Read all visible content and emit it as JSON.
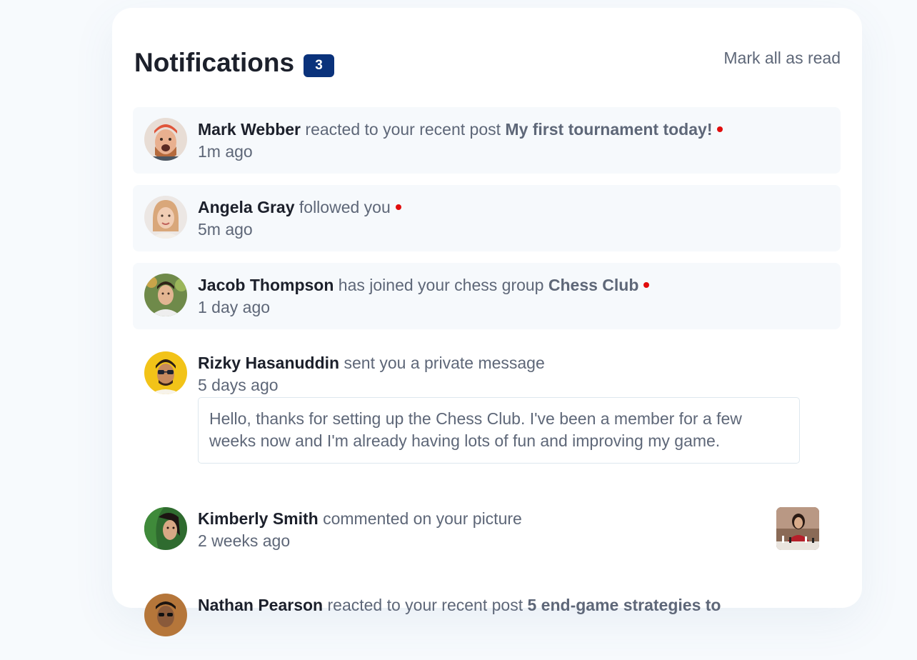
{
  "header": {
    "title": "Notifications",
    "unread_count": "3",
    "mark_all_label": "Mark all as read"
  },
  "notifications": [
    {
      "name": "Mark Webber",
      "action": "reacted to your recent post",
      "object": "My first tournament today!",
      "time": "1m ago",
      "unread": true,
      "avatar": "avatar-mark-webber"
    },
    {
      "name": "Angela Gray",
      "action": "followed you",
      "object": "",
      "time": "5m ago",
      "unread": true,
      "avatar": "avatar-angela-gray"
    },
    {
      "name": "Jacob Thompson",
      "action": "has joined your chess group",
      "object": "Chess Club",
      "time": "1 day ago",
      "unread": true,
      "avatar": "avatar-jacob-thompson"
    },
    {
      "name": "Rizky Hasanuddin",
      "action": "sent you a private message",
      "object": "",
      "time": "5 days ago",
      "unread": false,
      "message": "Hello, thanks for setting up the Chess Club. I've been a member for a few weeks now and I'm already having lots of fun and improving my game.",
      "avatar": "avatar-rizky-hasanuddin"
    },
    {
      "name": "Kimberly Smith",
      "action": "commented on your picture",
      "object": "",
      "time": "2 weeks ago",
      "unread": false,
      "avatar": "avatar-kimberly-smith",
      "thumbnail": "chess-picture-thumbnail"
    },
    {
      "name": "Nathan Pearson",
      "action": "reacted to your recent post",
      "object": "5 end-game strategies to",
      "time": "",
      "unread": false,
      "avatar": "avatar-nathan-pearson"
    }
  ],
  "colors": {
    "badge": "#0a327b",
    "unread_bg": "#f6f9fc",
    "unread_dot": "#e10d0d",
    "name_text": "#1c202b",
    "secondary_text": "#5e6778"
  }
}
